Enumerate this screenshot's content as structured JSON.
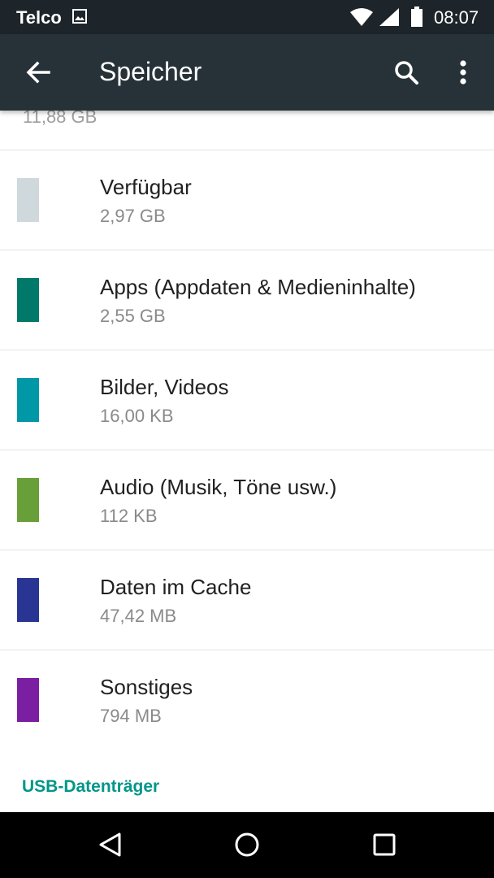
{
  "status_bar": {
    "carrier": "Telco",
    "time": "08:07",
    "icons": [
      "image-notification-icon",
      "wifi-icon",
      "signal-icon",
      "battery-icon"
    ]
  },
  "app_bar": {
    "title": "Speicher",
    "icons": [
      "back-arrow-icon",
      "search-icon",
      "more-vert-icon"
    ]
  },
  "storage": {
    "partial_total": "11,88 GB",
    "items": [
      {
        "label": "Verfügbar",
        "size": "2,97 GB",
        "color": "#cfd8dc"
      },
      {
        "label": "Apps (Appdaten & Medieninhalte)",
        "size": "2,55 GB",
        "color": "#00796b"
      },
      {
        "label": "Bilder, Videos",
        "size": "16,00 KB",
        "color": "#0097a7"
      },
      {
        "label": "Audio (Musik, Töne usw.)",
        "size": "112 KB",
        "color": "#689f38"
      },
      {
        "label": "Daten im Cache",
        "size": "47,42 MB",
        "color": "#283593"
      },
      {
        "label": "Sonstiges",
        "size": "794 MB",
        "color": "#7b1fa2"
      }
    ],
    "section_header": "USB-Datenträger"
  },
  "nav_bar": {
    "icons": [
      "nav-back-icon",
      "nav-home-icon",
      "nav-recents-icon"
    ]
  },
  "colors": {
    "status_bar_bg": "#1d252a",
    "app_bar_bg": "#263238",
    "accent": "#009688"
  }
}
